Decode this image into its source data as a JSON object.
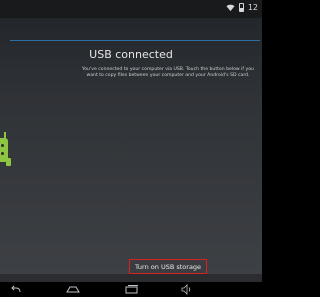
{
  "status_bar": {
    "time": "12",
    "icons": [
      "wifi-icon",
      "battery-icon"
    ]
  },
  "usb": {
    "title": "USB connected",
    "description": "You've connected to your computer via USB. Touch the button below if you want to copy files between your computer and your Android's SD card.",
    "button_label": "Turn on USB storage"
  },
  "nav_bar": {
    "icons": [
      "back-icon",
      "home-icon",
      "recent-apps-icon",
      "volume-icon"
    ]
  },
  "colors": {
    "accent_line": "#2e6fa5",
    "android_green": "#8ec541",
    "highlight_border": "#d22222"
  }
}
